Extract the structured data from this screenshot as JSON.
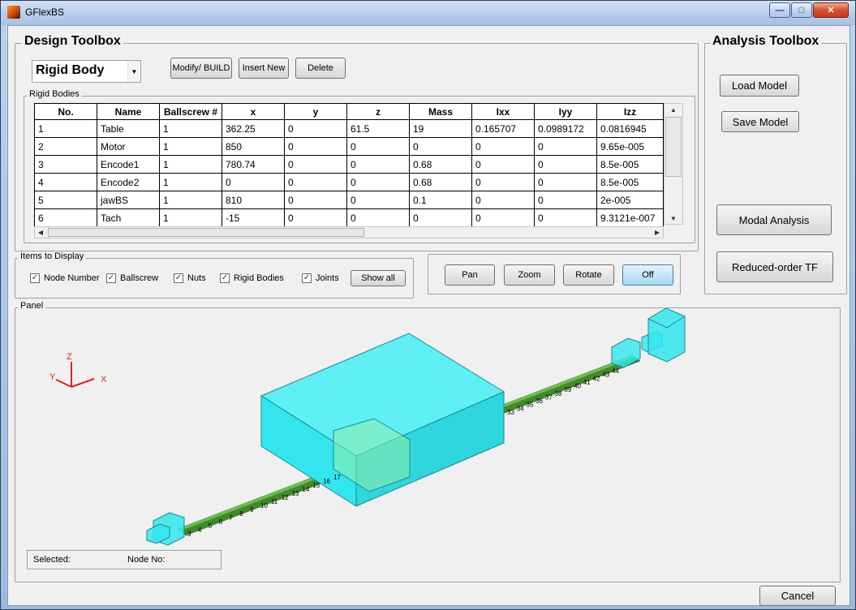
{
  "window": {
    "title": "GFlexBS",
    "minimize": "—",
    "maximize": "□",
    "close": "✕"
  },
  "design_toolbox": {
    "title": "Design Toolbox",
    "type_select": "Rigid Body",
    "modify_label": "Modify/ BUILD",
    "insert_label": "Insert New",
    "delete_label": "Delete",
    "table_title": "Rigid Bodies",
    "columns": [
      "No.",
      "Name",
      "Ballscrew #",
      "x",
      "y",
      "z",
      "Mass",
      "Ixx",
      "Iyy",
      "Izz"
    ],
    "rows": [
      [
        "1",
        "Table",
        "1",
        "362.25",
        "0",
        "61.5",
        "19",
        "0.165707",
        "0.0989172",
        "0.0816945"
      ],
      [
        "2",
        "Motor",
        "1",
        "850",
        "0",
        "0",
        "0",
        "0",
        "0",
        "9.65e-005"
      ],
      [
        "3",
        "Encode1",
        "1",
        "780.74",
        "0",
        "0",
        "0.68",
        "0",
        "0",
        "8.5e-005"
      ],
      [
        "4",
        "Encode2",
        "1",
        "0",
        "0",
        "0",
        "0.68",
        "0",
        "0",
        "8.5e-005"
      ],
      [
        "5",
        "jawBS",
        "1",
        "810",
        "0",
        "0",
        "0.1",
        "0",
        "0",
        "2e-005"
      ],
      [
        "6",
        "Tach",
        "1",
        "-15",
        "0",
        "0",
        "0",
        "0",
        "0",
        "9.3121e-007"
      ]
    ]
  },
  "items_to_display": {
    "title": "Items to Display",
    "node_number": "Node Number",
    "ballscrew": "Ballscrew",
    "nuts": "Nuts",
    "rigid_bodies": "Rigid Bodies",
    "joints": "Joints",
    "show_all": "Show all"
  },
  "view_tools": {
    "pan": "Pan",
    "zoom": "Zoom",
    "rotate": "Rotate",
    "off": "Off"
  },
  "analysis_toolbox": {
    "title": "Analysis Toolbox",
    "load_model": "Load Model",
    "save_model": "Save Model",
    "modal_analysis": "Modal Analysis",
    "reduced_order": "Reduced-order TF"
  },
  "panel": {
    "title": "Panel",
    "axis_x": "X",
    "axis_y": "Y",
    "axis_z": "Z",
    "selected_label": "Selected:",
    "node_no_label": "Node No:",
    "node_labels_lower": [
      "3",
      "4",
      "5",
      "6",
      "7",
      "8",
      "9",
      "10",
      "11",
      "12",
      "13",
      "14",
      "15",
      "16",
      "17"
    ],
    "node_labels_upper": [
      "33",
      "34",
      "35",
      "36",
      "37",
      "38",
      "39",
      "40",
      "41",
      "42",
      "43",
      "44"
    ]
  },
  "footer": {
    "cancel": "Cancel"
  },
  "colors": {
    "rigid_body": "#33e6ee",
    "ballscrew": "#3f8b2a",
    "nut": "#f5ef5c",
    "axis": "#e02020"
  }
}
